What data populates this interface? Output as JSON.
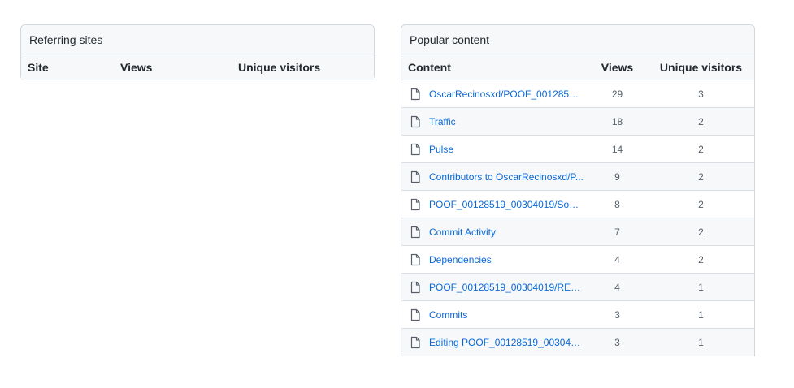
{
  "referring": {
    "title": "Referring sites",
    "columns": {
      "site": "Site",
      "views": "Views",
      "unique": "Unique visitors"
    }
  },
  "popular": {
    "title": "Popular content",
    "columns": {
      "content": "Content",
      "views": "Views",
      "unique": "Unique visitors"
    },
    "rows": [
      {
        "content": "OscarRecinosxd/POOF_00128519_...",
        "views": "29",
        "unique": "3"
      },
      {
        "content": "Traffic",
        "views": "18",
        "unique": "2"
      },
      {
        "content": "Pulse",
        "views": "14",
        "unique": "2"
      },
      {
        "content": "Contributors to OscarRecinosxd/P...",
        "views": "9",
        "unique": "2"
      },
      {
        "content": "POOF_00128519_00304019/Sourc...",
        "views": "8",
        "unique": "2"
      },
      {
        "content": "Commit Activity",
        "views": "7",
        "unique": "2"
      },
      {
        "content": "Dependencies",
        "views": "4",
        "unique": "2"
      },
      {
        "content": "POOF_00128519_00304019/READ...",
        "views": "4",
        "unique": "1"
      },
      {
        "content": "Commits",
        "views": "3",
        "unique": "1"
      },
      {
        "content": "Editing POOF_00128519_0030401...",
        "views": "3",
        "unique": "1"
      }
    ]
  },
  "icons": {
    "row_icon": "file-icon"
  },
  "colors": {
    "link": "#0969da",
    "header_bg": "#f6f8fa",
    "border": "#d0d7de"
  }
}
